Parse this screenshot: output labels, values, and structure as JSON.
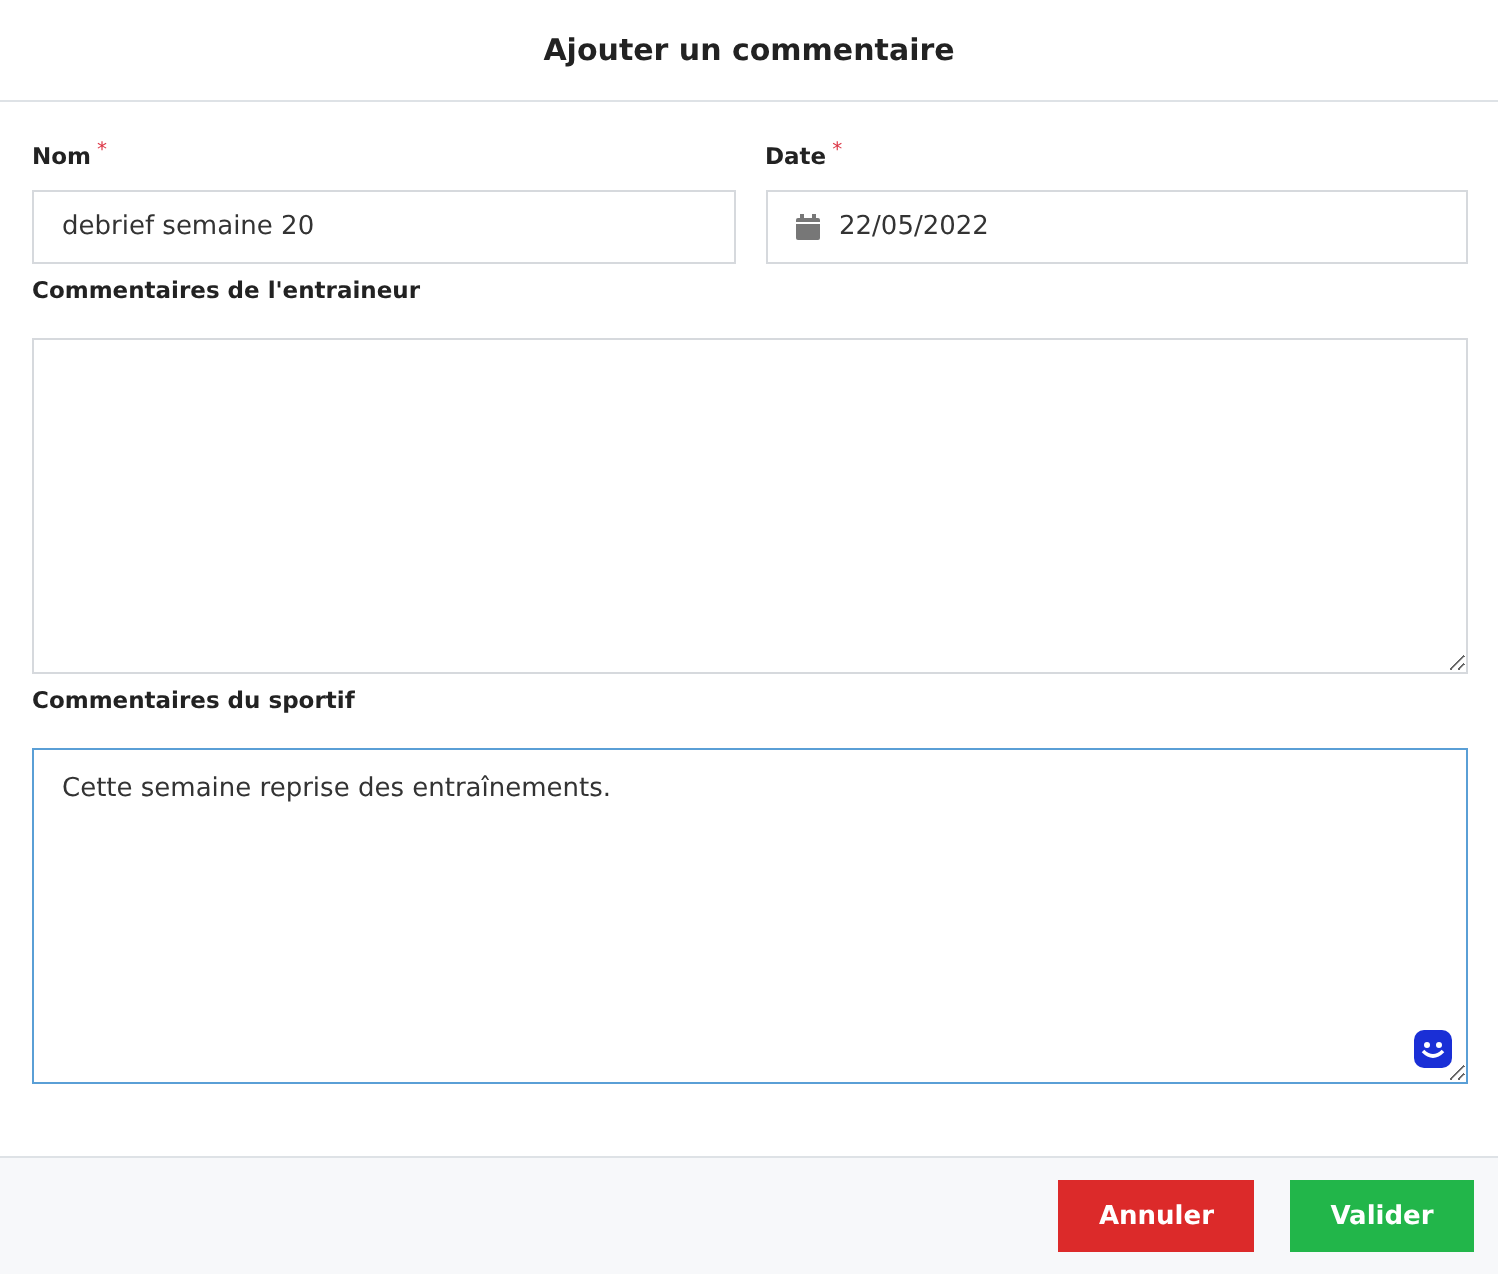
{
  "dialog": {
    "title": "Ajouter un commentaire"
  },
  "fields": [
    {
      "kind": "text",
      "label": "Nom",
      "required_mark": "*",
      "value": "debrief semaine 20"
    },
    {
      "kind": "date",
      "label": "Date",
      "required_mark": "*",
      "value": "22/05/2022"
    }
  ],
  "textareas": [
    {
      "label": "Commentaires de l'entraineur",
      "focused": false
    },
    {
      "label": "Commentaires du sportif",
      "value": "Cette semaine reprise des entraînements.",
      "focused": true,
      "emoji_button": true
    }
  ],
  "buttons": [
    {
      "kind": "cancel",
      "label": "Annuler"
    },
    {
      "kind": "submit",
      "label": "Valider"
    }
  ]
}
